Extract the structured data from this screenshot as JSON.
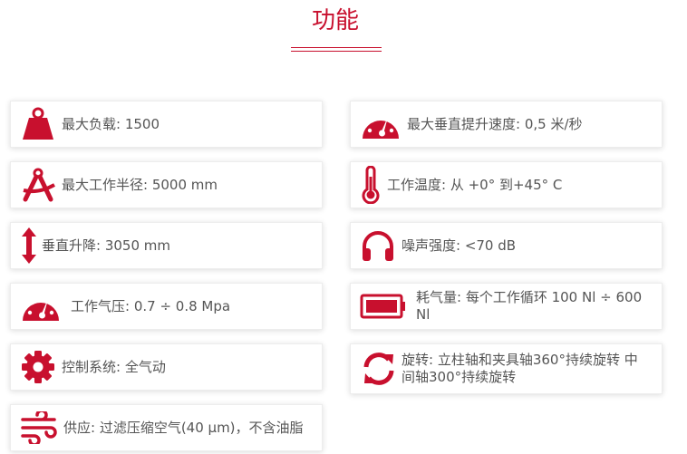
{
  "section": {
    "title": "功能"
  },
  "accent_color": "#c8102e",
  "features": [
    {
      "icon": "weight-icon",
      "text": "最大负载: 1500"
    },
    {
      "icon": "speedometer-icon",
      "text": "最大垂直提升速度: 0,5 米/秒"
    },
    {
      "icon": "compass-icon",
      "text": "最大工作半径: 5000 mm"
    },
    {
      "icon": "thermometer-icon",
      "text": "工作温度: 从 +0° 到+45° C"
    },
    {
      "icon": "vertical-arrows-icon",
      "text": "垂直升降: 3050 mm"
    },
    {
      "icon": "headphones-icon",
      "text": "噪声强度: <70 dB"
    },
    {
      "icon": "pressure-gauge-icon",
      "text": "工作气压: 0.7 ÷ 0.8 Mpa"
    },
    {
      "icon": "battery-icon",
      "text": "耗气量: 每个工作循环 100 Nl ÷ 600 Nl"
    },
    {
      "icon": "gear-icon",
      "text": "控制系统: 全气动"
    },
    {
      "icon": "rotation-icon",
      "text": "旋转: 立柱轴和夹具轴360°持续旋转 中间轴300°持续旋转"
    },
    {
      "icon": "air-flow-icon",
      "text": "供应: 过滤压缩空气(40 µm)，不含油脂"
    }
  ]
}
